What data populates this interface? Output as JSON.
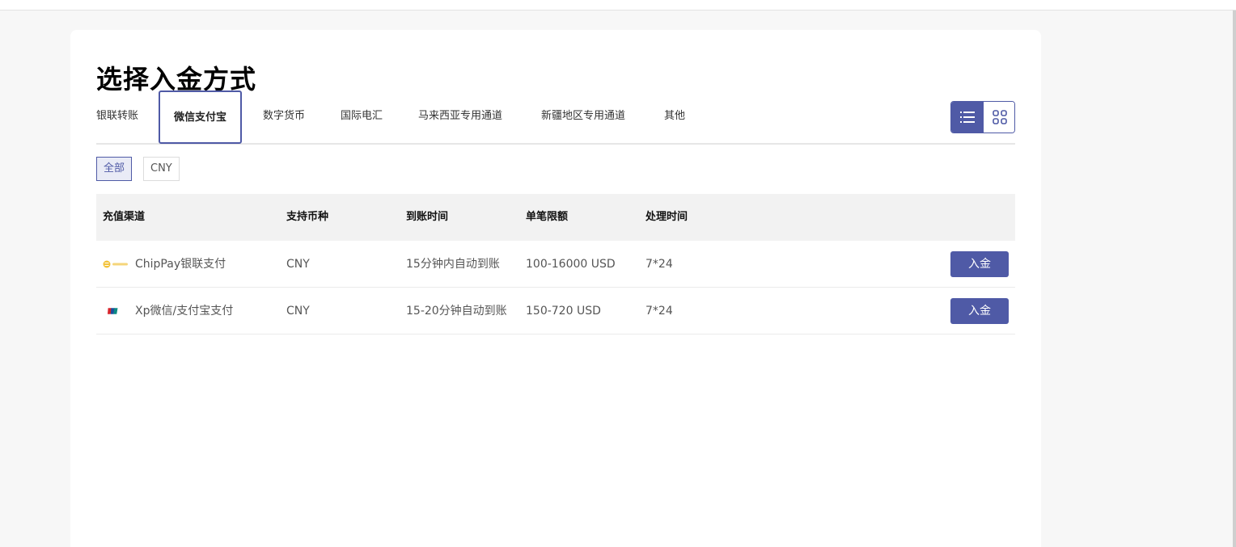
{
  "page": {
    "title": "选择入金方式"
  },
  "tabs": [
    {
      "label": "银联转账"
    },
    {
      "label": "微信支付宝"
    },
    {
      "label": "数字货币"
    },
    {
      "label": "国际电汇"
    },
    {
      "label": "马来西亚专用通道"
    },
    {
      "label": "新疆地区专用通道"
    },
    {
      "label": "其他"
    }
  ],
  "active_tab": "微信支付宝",
  "view_toggle": {
    "list_icon": "list-icon",
    "grid_icon": "grid-icon",
    "selected": "list"
  },
  "filters": [
    {
      "label": "全部"
    },
    {
      "label": "CNY"
    }
  ],
  "active_filter": "全部",
  "table": {
    "headers": {
      "channel": "充值渠道",
      "currency": "支持币种",
      "arrival": "到账时间",
      "limit": "单笔限额",
      "process": "处理时间"
    },
    "rows": [
      {
        "logo": "chippay-logo-icon",
        "channel": "ChipPay银联支付",
        "currency": "CNY",
        "arrival": "15分钟内自动到账",
        "limit": "100-16000 USD",
        "process": "7*24",
        "action": "入金"
      },
      {
        "logo": "unionpay-logo-icon",
        "channel": "Xp微信/支付宝支付",
        "currency": "CNY",
        "arrival": "15-20分钟自动到账",
        "limit": "150-720 USD",
        "process": "7*24",
        "action": "入金"
      }
    ]
  },
  "colors": {
    "accent": "#4f5aa6",
    "header_bg": "#f2f2f2",
    "page_bg": "#f7f7f7"
  }
}
